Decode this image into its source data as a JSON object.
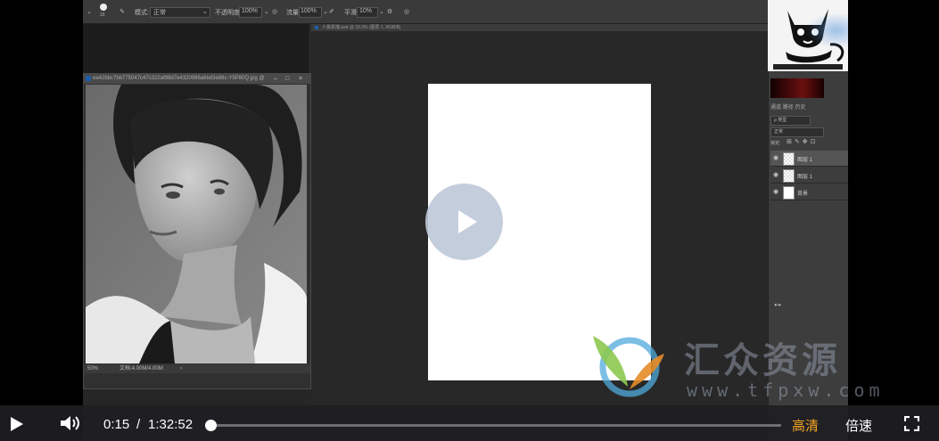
{
  "options_bar": {
    "mode_label": "模式:",
    "mode_value": "正常",
    "opacity_label": "不透明度:",
    "opacity_value": "100%",
    "flow_label": "流量:",
    "flow_value": "100%",
    "smooth_label": "平滑:",
    "smooth_value": "10%",
    "brush_size": "15"
  },
  "doc_window": {
    "title": "ea42bbc7bb775047c47c322af98d7e4320066a6bd3e88c-Y5P80Q.jpg @",
    "zoom": "50%",
    "doc_info": "文档:4.00M/4.00M"
  },
  "canvas": {
    "tab_title": "人像素描.psd @ 33.3% (图层 1, RGB/8)"
  },
  "layers_panel": {
    "tabs": "通道  路径  历史",
    "kind_label": "ρ 类型",
    "blend_mode": "正常",
    "lock_label": "锁定:",
    "layers": [
      {
        "name": "图层 1",
        "thumb": "checker"
      },
      {
        "name": "图层 1",
        "thumb": "checker"
      },
      {
        "name": "背景",
        "thumb": "white"
      }
    ]
  },
  "watermark": {
    "text": "汇众资源",
    "url": "www.tfpxw.com"
  },
  "player": {
    "current_time": "0:15",
    "separator": "/",
    "duration": "1:32:52",
    "progress_fraction": 0.003,
    "quality_label": "高清",
    "speed_label": "倍速",
    "accent_color": "#f5a623"
  }
}
